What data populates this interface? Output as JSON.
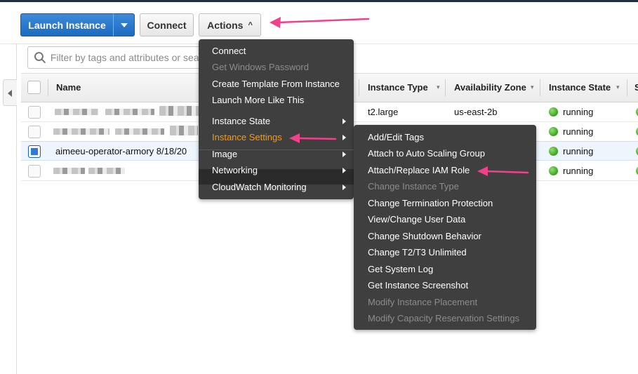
{
  "toolbar": {
    "launch_label": "Launch Instance",
    "connect_label": "Connect",
    "actions_label": "Actions",
    "actions_chevron": "^"
  },
  "search": {
    "placeholder": "Filter by tags and attributes or search"
  },
  "table": {
    "columns": [
      "Name",
      "Instance Type",
      "Availability Zone",
      "Instance State",
      "S"
    ],
    "rows": [
      {
        "name": "",
        "name_hidden": true,
        "instance_type": "t2.large",
        "availability_zone": "us-east-2b",
        "state": "running",
        "selected": false
      },
      {
        "name": "",
        "name_hidden": true,
        "instance_type": "",
        "availability_zone": "",
        "state": "running",
        "selected": false
      },
      {
        "name": "aimeeu-operator-armory 8/18/20",
        "name_hidden": false,
        "instance_type": "",
        "availability_zone": "",
        "state": "running",
        "selected": true
      },
      {
        "name": "",
        "name_hidden": true,
        "instance_type": "",
        "availability_zone": "",
        "state": "running",
        "selected": false
      }
    ]
  },
  "actions_menu": {
    "items": [
      {
        "label": "Connect",
        "disabled": false
      },
      {
        "label": "Get Windows Password",
        "disabled": true
      },
      {
        "label": "Create Template From Instance",
        "disabled": false
      },
      {
        "label": "Launch More Like This",
        "disabled": false
      },
      {
        "label": "Instance State",
        "submenu": true
      },
      {
        "label": "Instance Settings",
        "submenu": true,
        "active": true
      },
      {
        "label": "Image",
        "submenu": true
      },
      {
        "label": "Networking",
        "submenu": true
      },
      {
        "label": "CloudWatch Monitoring",
        "submenu": true
      }
    ]
  },
  "settings_menu": {
    "items": [
      {
        "label": "Add/Edit Tags",
        "disabled": false
      },
      {
        "label": "Attach to Auto Scaling Group",
        "disabled": false
      },
      {
        "label": "Attach/Replace IAM Role",
        "disabled": false
      },
      {
        "label": "Change Instance Type",
        "disabled": true
      },
      {
        "label": "Change Termination Protection",
        "disabled": false
      },
      {
        "label": "View/Change User Data",
        "disabled": false
      },
      {
        "label": "Change Shutdown Behavior",
        "disabled": false
      },
      {
        "label": "Change T2/T3 Unlimited",
        "disabled": false
      },
      {
        "label": "Get System Log",
        "disabled": false
      },
      {
        "label": "Get Instance Screenshot",
        "disabled": false
      },
      {
        "label": "Modify Instance Placement",
        "disabled": true
      },
      {
        "label": "Modify Capacity Reservation Settings",
        "disabled": true
      }
    ]
  },
  "colors": {
    "primary_button": "#1b6ac0",
    "menu_background": "#3f3f3f",
    "active_menu_text": "#ff9900",
    "running_dot": "#3aa21e",
    "annotation_arrow": "#f0418a"
  },
  "icons": [
    "search-icon",
    "chevron-down-icon",
    "chevron-up-icon",
    "submenu-arrow-icon",
    "collapse-left-icon",
    "status-running-icon"
  ]
}
